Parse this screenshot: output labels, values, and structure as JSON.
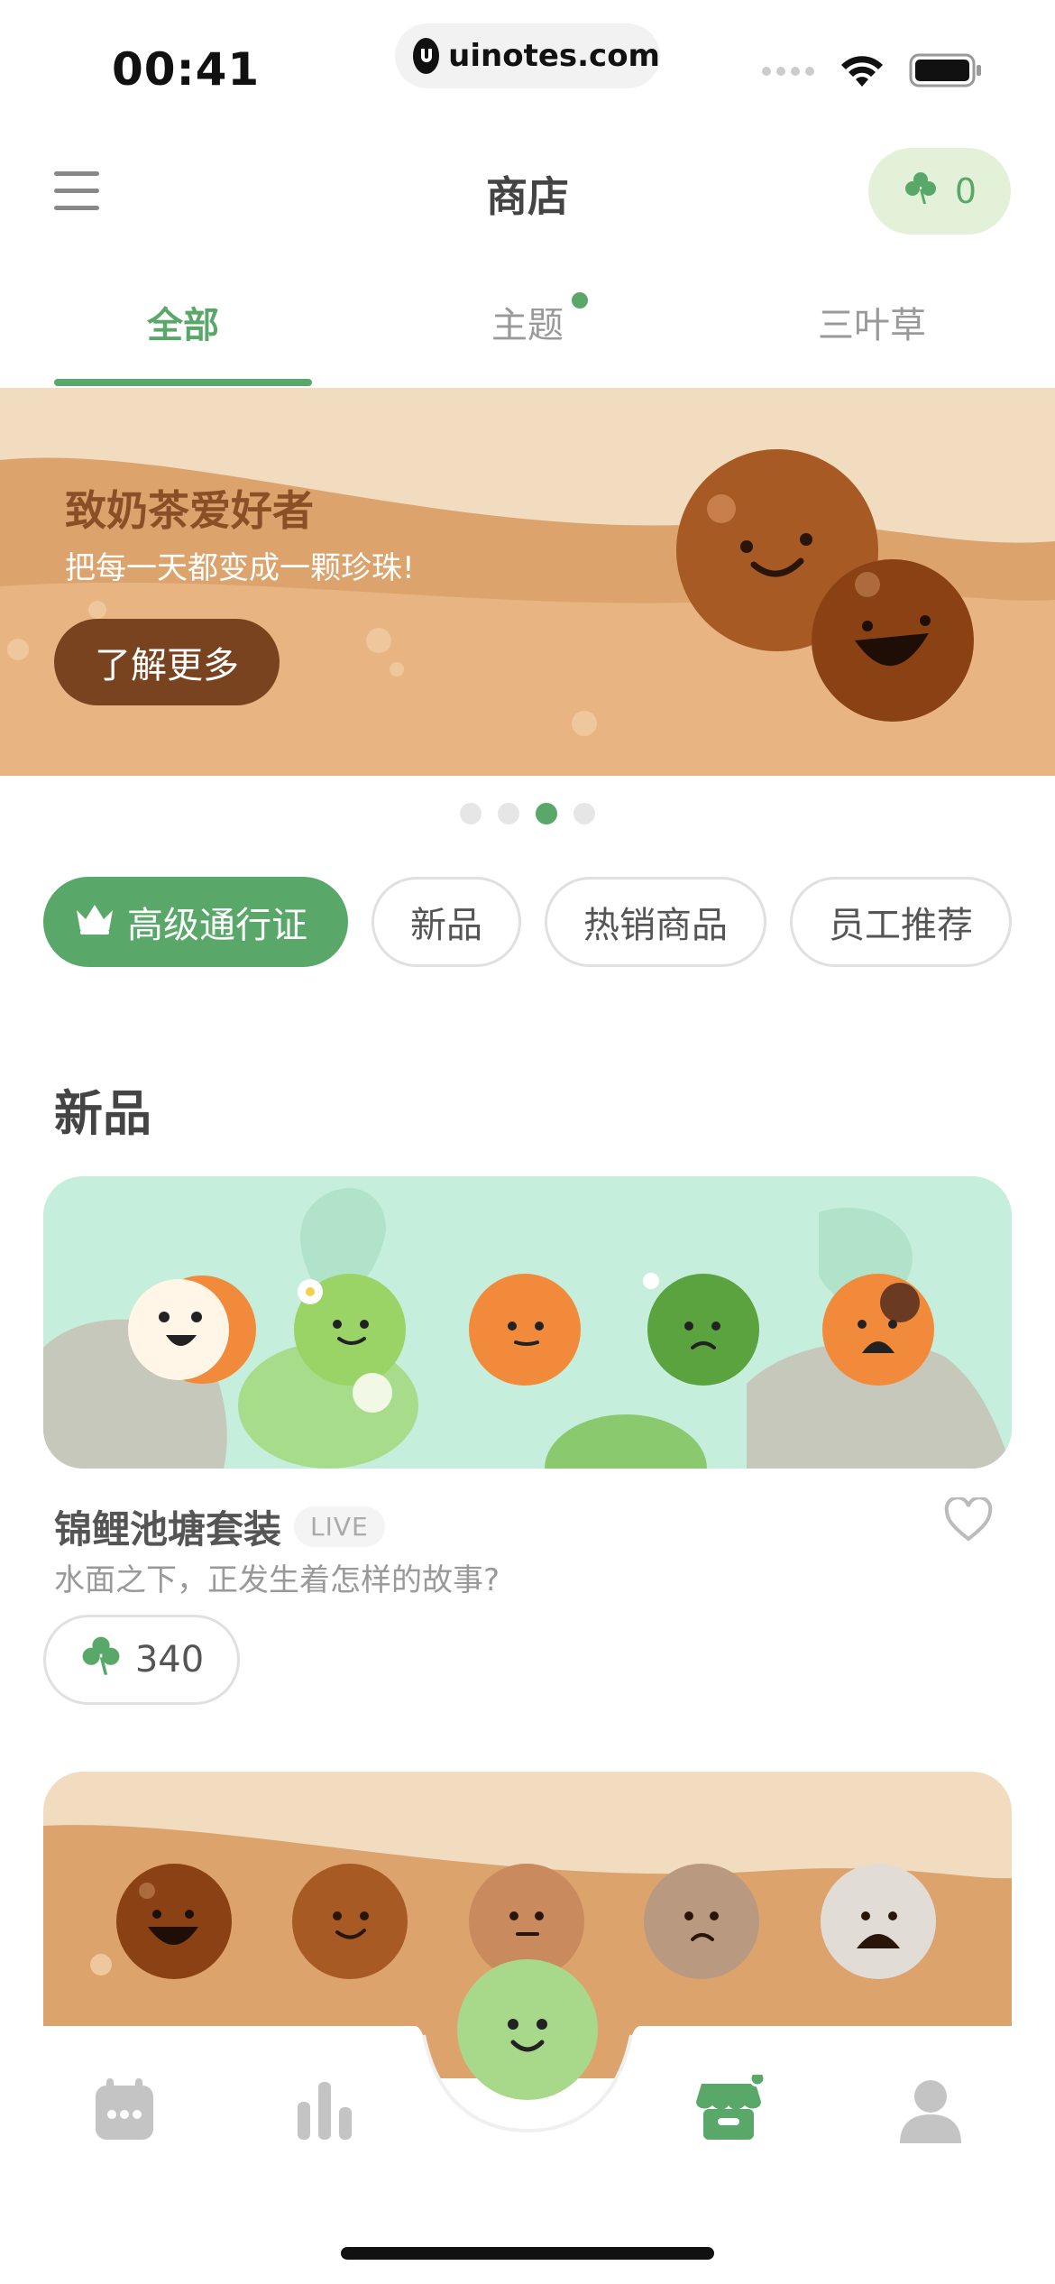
{
  "status_bar": {
    "time": "00:41",
    "url": "uinotes.com"
  },
  "header": {
    "title": "商店",
    "clover_count": "0"
  },
  "tabs": [
    {
      "label": "全部",
      "active": true
    },
    {
      "label": "主题",
      "active": false,
      "has_dot": true
    },
    {
      "label": "三叶草",
      "active": false
    }
  ],
  "banner": {
    "title": "致奶茶爱好者",
    "subtitle": "把每一天都变成一颗珍珠!",
    "button_label": "了解更多",
    "active_page": 3,
    "page_count": 4
  },
  "filter_chips": [
    {
      "label": "高级通行证",
      "selected": true,
      "icon": "crown-icon"
    },
    {
      "label": "新品",
      "selected": false
    },
    {
      "label": "热销商品",
      "selected": false
    },
    {
      "label": "员工推荐",
      "selected": false
    }
  ],
  "section": {
    "title": "新品",
    "items": [
      {
        "name": "锦鲤池塘套装",
        "badge": "LIVE",
        "description": "水面之下，正发生着怎样的故事?",
        "price": "340"
      }
    ]
  },
  "bottom_nav": {
    "items": [
      "calendar-icon",
      "stats-icon",
      "mood-add-icon",
      "store-icon",
      "profile-icon"
    ],
    "active": "store-icon"
  },
  "colors": {
    "accent": "#59a869",
    "banner_bg": "#f2dcc0",
    "banner_button": "#7a4320",
    "koi_bg": "#c6eedc"
  }
}
